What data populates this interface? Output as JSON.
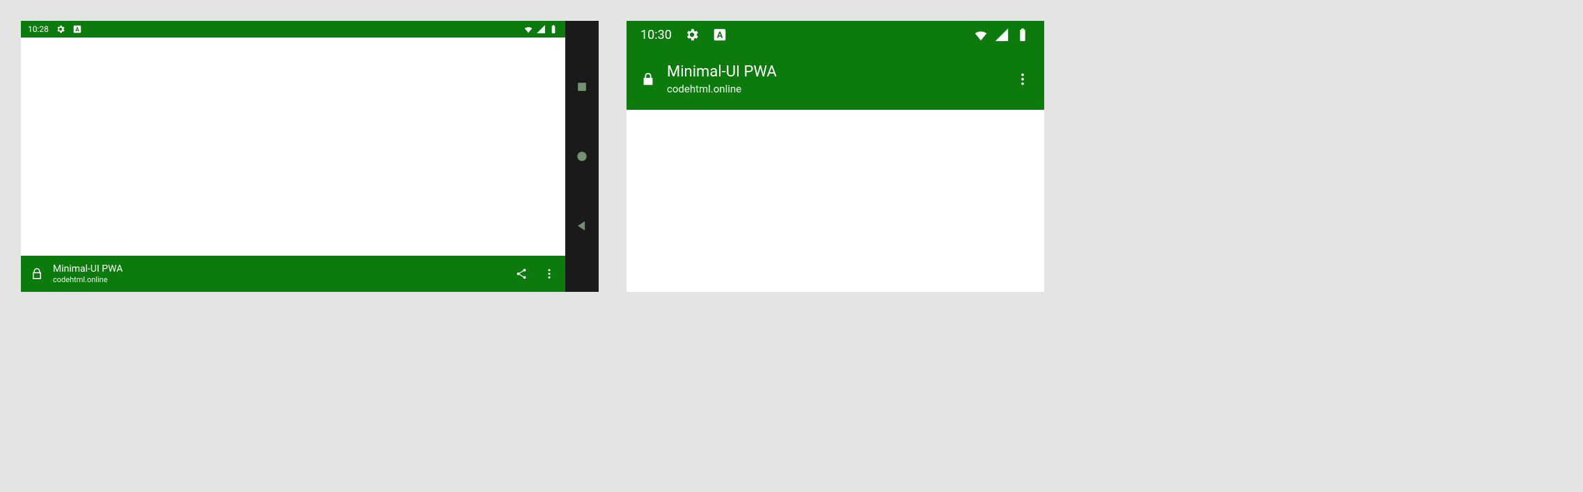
{
  "left": {
    "status": {
      "time": "10:28"
    },
    "app": {
      "title": "Minimal-UI PWA",
      "url": "codehtml.online"
    }
  },
  "right": {
    "status": {
      "time": "10:30"
    },
    "app": {
      "title": "Minimal-UI PWA",
      "url": "codehtml.online"
    }
  }
}
